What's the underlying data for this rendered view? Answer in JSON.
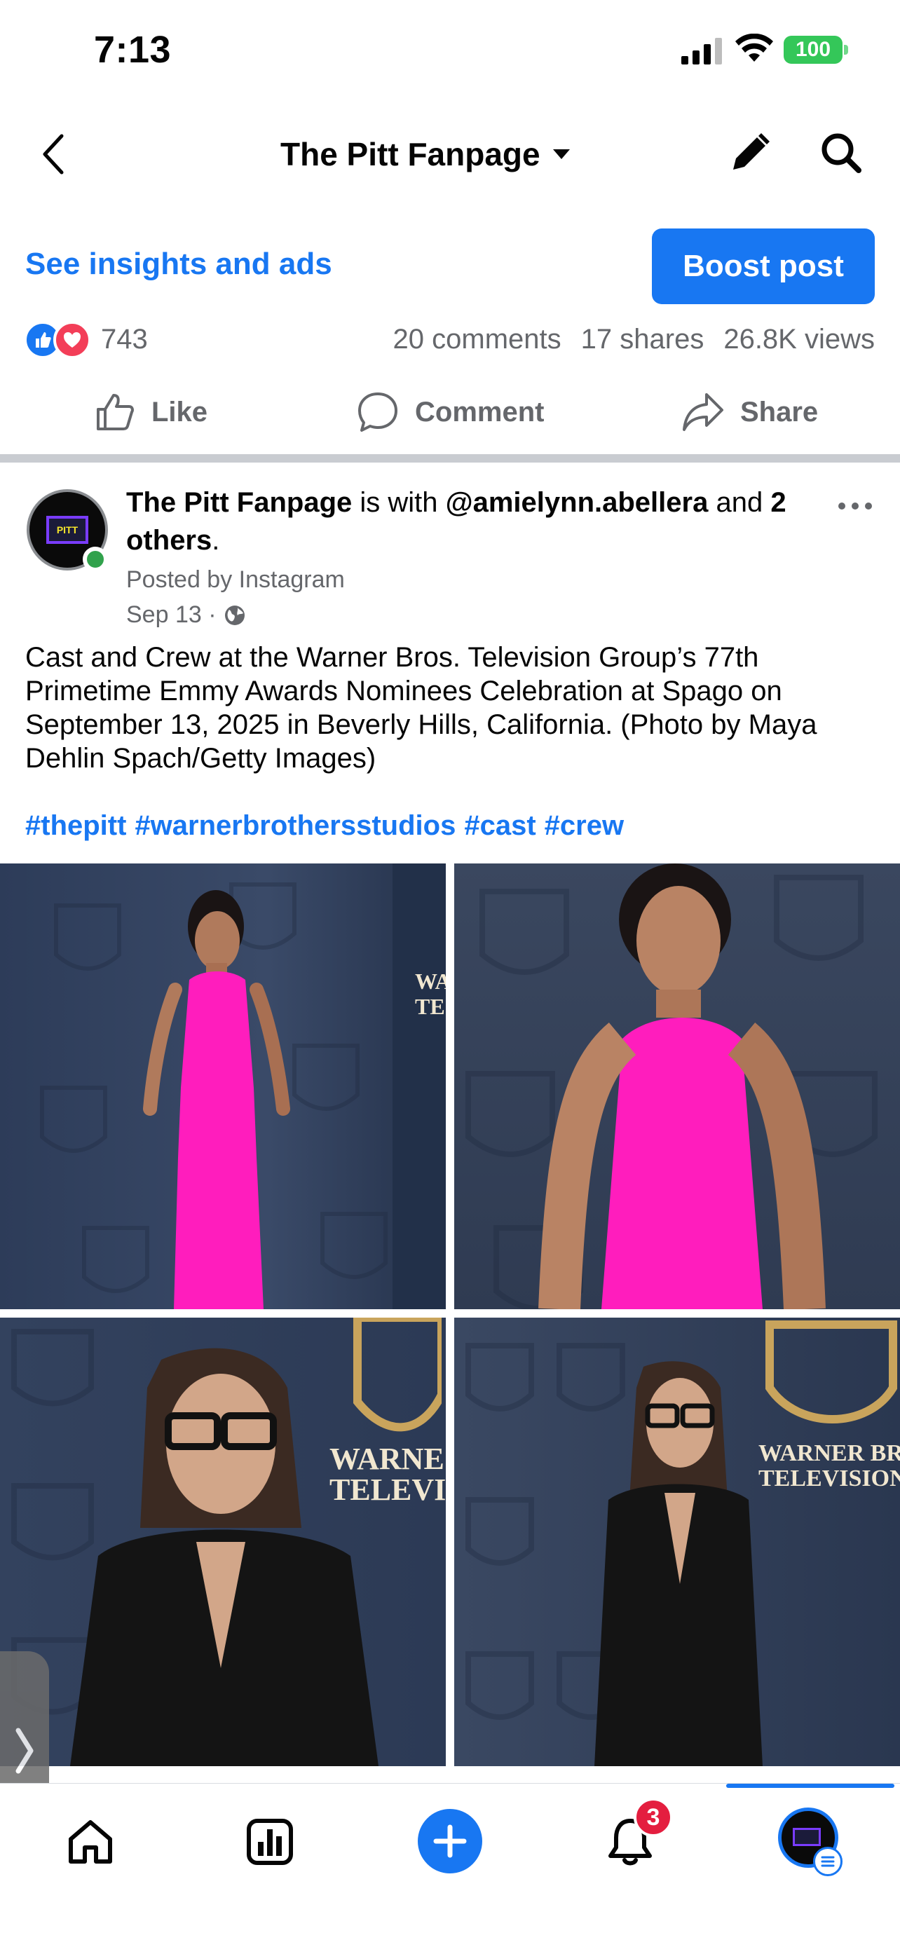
{
  "status_bar": {
    "time": "7:13",
    "battery": "100"
  },
  "header": {
    "page_title": "The Pitt Fanpage",
    "icons": [
      "back-arrow-icon",
      "caret-down-icon",
      "pencil-icon",
      "search-icon"
    ]
  },
  "promo": {
    "insights_label": "See insights and ads",
    "boost_label": "Boost post"
  },
  "stats": {
    "reaction_count": "743",
    "comments": "20 comments",
    "shares": "17 shares",
    "views": "26.8K views"
  },
  "actions": {
    "like": "Like",
    "comment": "Comment",
    "share": "Share"
  },
  "post": {
    "author": "The Pitt Fanpage",
    "with_text": " is with ",
    "tagged": "@amielynn.abellera",
    "and_text": " and ",
    "others": "2 others",
    "period": ".",
    "posted_by": "Posted by Instagram",
    "date": "Sep 13 ·",
    "avatar_text": "PITT",
    "caption": "Cast and Crew at the Warner Bros. Television Group’s 77th Primetime Emmy Awards Nominees Celebration at Spago on September 13, 2025 in Beverly Hills, California. (Photo by Maya Dehlin Spach/Getty Images)",
    "hashtags": [
      "#thepitt",
      "#warnerbrothersstudios",
      "#cast",
      "#crew"
    ]
  },
  "photos": {
    "photo1_backdrop": "WA\nTE",
    "photo3_backdrop": "WARNE\nTELEVISIO",
    "photo4_backdrop": "WARNER BRO\nTELEVISION GROU"
  },
  "bottom_nav": {
    "notification_count": "3"
  },
  "colors": {
    "accent": "#1877f2",
    "secondary_text": "#65676b",
    "badge": "#e41e3f",
    "online": "#31a24c"
  }
}
